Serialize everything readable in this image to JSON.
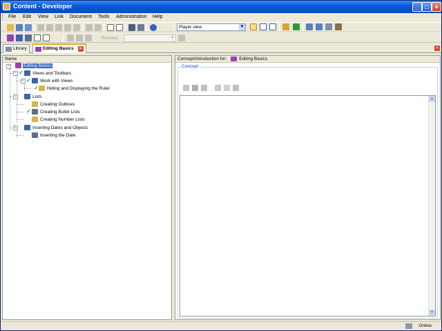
{
  "window": {
    "title": "Content - Developer"
  },
  "menu": [
    "File",
    "Edit",
    "View",
    "Link",
    "Document",
    "Tools",
    "Administration",
    "Help"
  ],
  "toolbar2": {
    "view_select": "Player view"
  },
  "toolbar3": {
    "preview_label": "Preview:"
  },
  "tabs": [
    {
      "label": "Library",
      "icon": "library-icon"
    },
    {
      "label": "Editing Basics",
      "icon": "outline-icon"
    }
  ],
  "tree": {
    "header": "Name",
    "nodes": [
      {
        "label": "Editing Basics",
        "icon": "module-icon",
        "checked": false
      },
      {
        "label": "Views and Toolbars",
        "icon": "section-icon",
        "checked": true
      },
      {
        "label": "Work with Views",
        "icon": "section-icon",
        "checked": true
      },
      {
        "label": "Hiding and Displaying the Ruler",
        "icon": "topic-icon",
        "checked": true
      },
      {
        "label": "Lists",
        "icon": "section-icon",
        "checked": false
      },
      {
        "label": "Creating Outlines",
        "icon": "topic-icon",
        "checked": false
      },
      {
        "label": "Creating Bullet Lists",
        "icon": "topic-icon",
        "checked": true
      },
      {
        "label": "Creating Number Lists",
        "icon": "topic-icon",
        "checked": false
      },
      {
        "label": "Inserting Dates and Objects",
        "icon": "section-icon",
        "checked": false
      },
      {
        "label": "Inserting the Date",
        "icon": "topic-icon",
        "checked": false
      }
    ]
  },
  "concept": {
    "header_label": "Concept/Introduction for:",
    "header_value": "Editing Basics",
    "group_label": "Concept"
  },
  "status": {
    "online": "Online"
  }
}
